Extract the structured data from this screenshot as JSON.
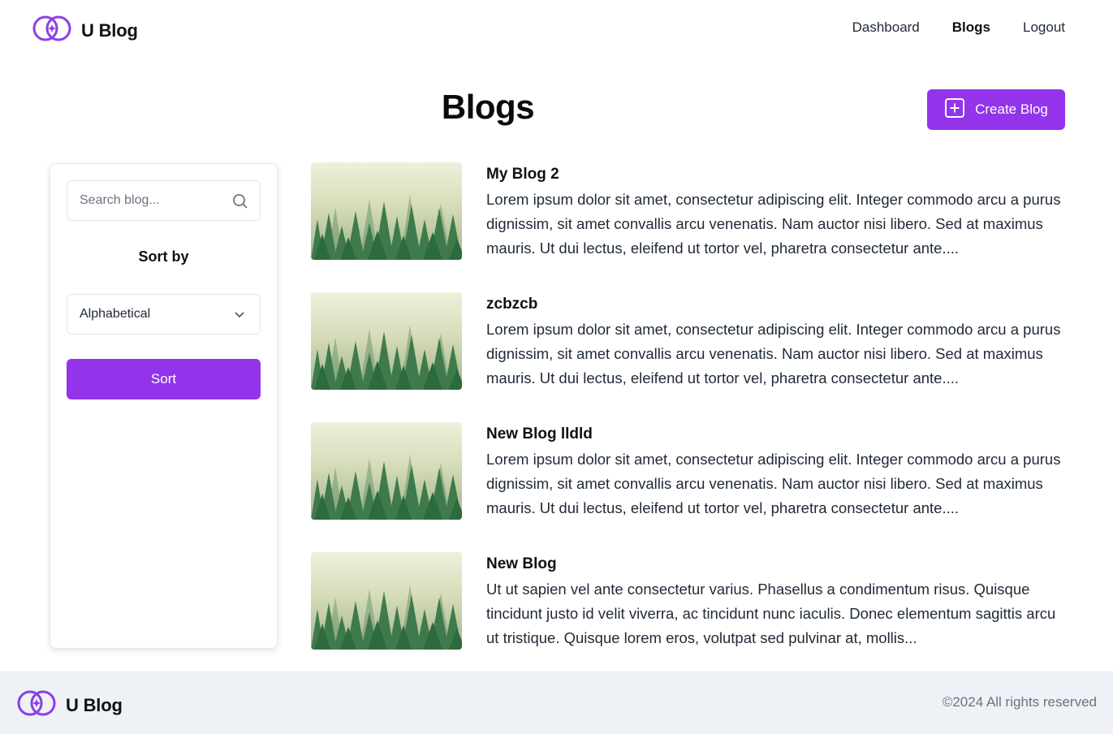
{
  "header": {
    "brand": "U Blog",
    "nav": [
      {
        "label": "Dashboard",
        "active": false
      },
      {
        "label": "Blogs",
        "active": true
      },
      {
        "label": "Logout",
        "active": false
      }
    ]
  },
  "main": {
    "title": "Blogs",
    "create_button": {
      "label": "Create Blog",
      "icon": "plus-square-icon"
    }
  },
  "sidebar": {
    "search_placeholder": "Search blog...",
    "search_value": "",
    "sort_label": "Sort by",
    "sort_selected": "Alphabetical",
    "sort_button": "Sort"
  },
  "blogs": [
    {
      "title": "My Blog 2",
      "excerpt": "Lorem ipsum dolor sit amet, consectetur adipiscing elit. Integer commodo arcu a purus dignissim, sit amet convallis arcu venenatis. Nam auctor nisi libero. Sed at maximus mauris. Ut dui lectus, eleifend ut tortor vel, pharetra consectetur ante...."
    },
    {
      "title": "zcbzcb",
      "excerpt": "Lorem ipsum dolor sit amet, consectetur adipiscing elit. Integer commodo arcu a purus dignissim, sit amet convallis arcu venenatis. Nam auctor nisi libero. Sed at maximus mauris. Ut dui lectus, eleifend ut tortor vel, pharetra consectetur ante...."
    },
    {
      "title": "New Blog lldld",
      "excerpt": "Lorem ipsum dolor sit amet, consectetur adipiscing elit. Integer commodo arcu a purus dignissim, sit amet convallis arcu venenatis. Nam auctor nisi libero. Sed at maximus mauris. Ut dui lectus, eleifend ut tortor vel, pharetra consectetur ante...."
    },
    {
      "title": "New Blog",
      "excerpt": "Ut ut sapien vel ante consectetur varius. Phasellus a condimentum risus. Quisque tincidunt justo id velit viverra, ac tincidunt nunc iaculis. Donec elementum sagittis arcu ut tristique. Quisque lorem eros, volutpat sed pulvinar at, mollis..."
    }
  ],
  "footer": {
    "brand": "U Blog",
    "copyright": "©2024 All rights reserved"
  },
  "colors": {
    "accent": "#9333ea",
    "footer_bg": "#eef2f7"
  }
}
